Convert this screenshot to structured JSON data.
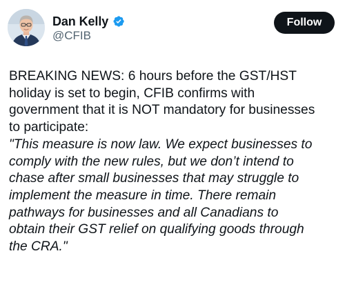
{
  "author": {
    "display_name": "Dan Kelly",
    "handle": "@CFIB",
    "verified": true,
    "verified_color": "#1d9bf0"
  },
  "follow_button": {
    "label": "Follow",
    "background": "#0f1419",
    "text_color": "#ffffff"
  },
  "tweet": {
    "body": "BREAKING NEWS: 6 hours before the GST/HST\nholiday is set to begin, CFIB confirms with\ngovernment that it is NOT mandatory for businesses\nto participate:",
    "quote": "\"This measure is now law. We expect businesses to\ncomply with the new rules, but we don’t intend to\nchase after small businesses that may struggle to\nimplement the measure in time. There remain\npathways for businesses and all Canadians to\nobtain their GST relief on qualifying goods through\nthe CRA.\""
  },
  "icons": {
    "avatar": "profile-photo",
    "verified": "verified-badge-icon"
  }
}
